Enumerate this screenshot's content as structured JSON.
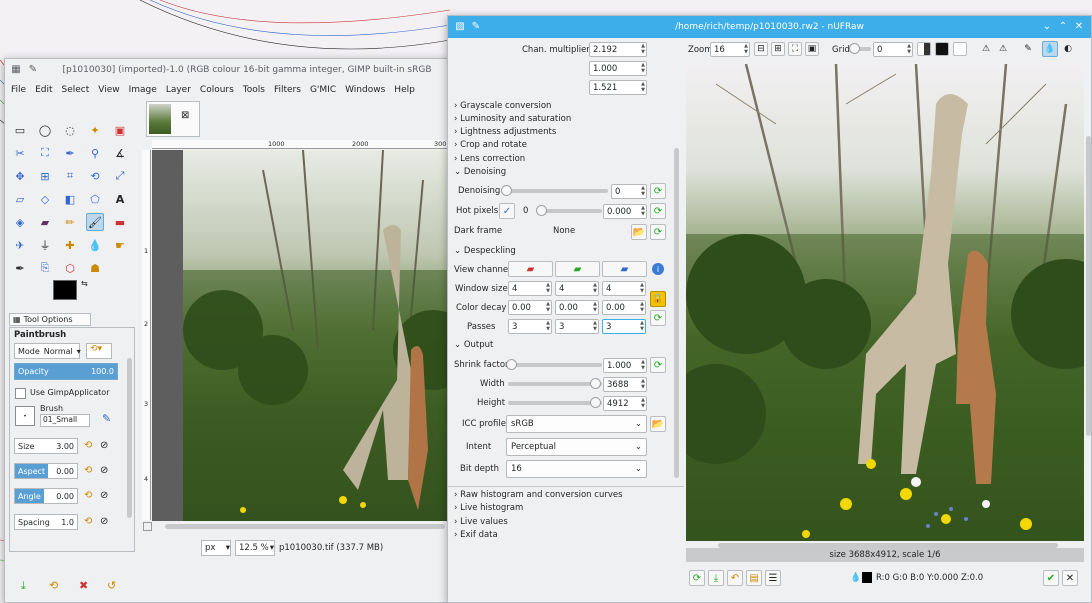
{
  "gimp": {
    "title": "[p1010030] (imported)-1.0 (RGB colour 16-bit gamma integer, GIMP built-in sRGB",
    "menu": [
      "File",
      "Edit",
      "Select",
      "View",
      "Image",
      "Layer",
      "Colours",
      "Tools",
      "Filters",
      "G'MIC",
      "Windows",
      "Help"
    ],
    "ruler": [
      "1000",
      "2000",
      "300"
    ],
    "ruler_v": [
      "1",
      "2",
      "3",
      "4"
    ],
    "tool_options_tab": "Tool Options",
    "tool_name": "Paintbrush",
    "mode_label": "Mode",
    "mode_value": "Normal",
    "opacity_label": "Opacity",
    "opacity_value": "100.0",
    "gimpapplicator_label": "Use GimpApplicator",
    "brush_label": "Brush",
    "brush_value": "01_Small",
    "size_label": "Size",
    "size_value": "3.00",
    "aspect_label": "Aspect",
    "aspect_value": "0.00",
    "angle_label": "Angle",
    "angle_value": "0.00",
    "spacing_label": "Spacing",
    "spacing_value": "1.0",
    "unit": "px",
    "zoom": "12.5 %",
    "status": "p1010030.tif (337.7 MB)"
  },
  "ufraw": {
    "title": "/home/rich/temp/p1010030.rw2 - nUFRaw",
    "chan_label": "Chan. multipliers",
    "chan": [
      "2.192",
      "1.000",
      "1.521"
    ],
    "sections_collapsed": [
      "Grayscale conversion",
      "Luminosity and saturation",
      "Lightness adjustments",
      "Crop and rotate",
      "Lens correction"
    ],
    "denoising_header": "Denoising",
    "denoising_label": "Denoising",
    "denoising_value": "0",
    "hotpixels_label": "Hot pixels",
    "hotpixels_count": "0",
    "hotpixels_value": "0.000",
    "darkframe_label": "Dark frame",
    "darkframe_value": "None",
    "despeckling_header": "Despeckling",
    "viewchannel_label": "View channel",
    "windowsize_label": "Window size",
    "windowsize": [
      "4",
      "4",
      "4"
    ],
    "colordecay_label": "Color decay",
    "colordecay": [
      "0.00",
      "0.00",
      "0.00"
    ],
    "passes_label": "Passes",
    "passes": [
      "3",
      "3",
      "3"
    ],
    "output_header": "Output",
    "shrink_label": "Shrink factor",
    "shrink_value": "1.000",
    "width_label": "Width",
    "width_value": "3688",
    "height_label": "Height",
    "height_value": "4912",
    "icc_label": "ICC profile",
    "icc_value": "sRGB",
    "intent_label": "Intent",
    "intent_value": "Perceptual",
    "bitdepth_label": "Bit depth",
    "bitdepth_value": "16",
    "sections_bottom": [
      "Raw histogram and conversion curves",
      "Live histogram",
      "Live values",
      "Exif data"
    ],
    "zoom_label": "Zoom",
    "zoom_value": "16",
    "grid_label": "Grid",
    "grid_value": "0",
    "size_status": "size 3688x4912, scale 1/6",
    "pixel_values": "R:0 G:0 B:0 Y:0.000 Z:0.0"
  }
}
